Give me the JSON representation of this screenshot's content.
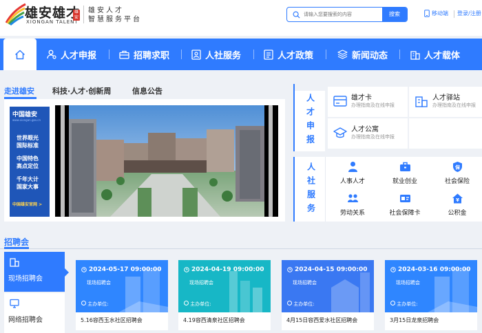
{
  "header": {
    "logo_title": "雄安雄才",
    "logo_en": "XIONGAN TALENT",
    "logo_seal": "雄安",
    "subtitle_line1": "雄安人才",
    "subtitle_line2": "智慧服务平台",
    "search_placeholder": "请输入您要搜索的内容",
    "search_button": "搜索",
    "mobile_link": "移动端",
    "login_link": "登录/注册"
  },
  "nav": {
    "items": [
      {
        "label": "人才申报",
        "icon": "user-badge-icon"
      },
      {
        "label": "招聘求职",
        "icon": "briefcase-icon"
      },
      {
        "label": "人社服务",
        "icon": "id-card-icon"
      },
      {
        "label": "人才政策",
        "icon": "document-icon"
      },
      {
        "label": "新闻动态",
        "icon": "layers-icon"
      },
      {
        "label": "人才载体",
        "icon": "building-icon"
      }
    ]
  },
  "news_tabs": [
    "走进雄安",
    "科技·人才·创新周",
    "信息公告"
  ],
  "ad": {
    "title": "中国雄安",
    "site": "www.xiongan.gov.cn",
    "lines": [
      "世界眼光",
      "国际标准",
      "中国特色",
      "高点定位",
      "千年大计",
      "国家大事"
    ],
    "bottom": "中国雄安官网 >"
  },
  "services": {
    "talent_declare": {
      "label": "人才申报",
      "items": [
        {
          "title": "雄才卡",
          "sub": "办理指南及在线申报",
          "icon": "card-icon"
        },
        {
          "title": "人才驿站",
          "sub": "办理指南及在线申报",
          "icon": "building-icon"
        },
        {
          "title": "人才公寓",
          "sub": "办理指南及在线申报",
          "icon": "graduation-cap-icon"
        }
      ]
    },
    "social_service": {
      "label": "人社服务",
      "items": [
        {
          "title": "人事人才",
          "icon": "person-icon"
        },
        {
          "title": "就业创业",
          "icon": "briefcase-icon"
        },
        {
          "title": "社会保险",
          "icon": "shield-icon"
        },
        {
          "title": "劳动关系",
          "icon": "people-icon"
        },
        {
          "title": "社会保障卡",
          "icon": "card-icon"
        },
        {
          "title": "公积金",
          "icon": "house-coin-icon"
        }
      ]
    }
  },
  "jobs": {
    "title": "招聘会",
    "side": [
      {
        "label": "现场招聘会",
        "icon": "building-icon"
      },
      {
        "label": "网络招聘会",
        "icon": "monitor-icon"
      }
    ],
    "cards": [
      {
        "date": "2024-05-17 09:00:00",
        "type": "现场招聘会",
        "organizer": "主办单位:",
        "name": "5.16容西玉水社区招聘会",
        "color": "#2f86ff"
      },
      {
        "date": "2024-04-19 09:00:00",
        "type": "现场招聘会",
        "organizer": "主办单位:",
        "name": "4.19容西清泉社区招聘会",
        "color": "#17b7c6"
      },
      {
        "date": "2024-04-15 09:00:00",
        "type": "现场招聘会",
        "organizer": "主办单位:",
        "name": "4月15日容西爱水社区招聘会",
        "color": "#3a78f2"
      },
      {
        "date": "2024-03-16 09:00:00",
        "type": "现场招聘会",
        "organizer": "主办单位:",
        "name": "3月15日龙泉招聘会",
        "color": "#2f86ff"
      }
    ]
  }
}
